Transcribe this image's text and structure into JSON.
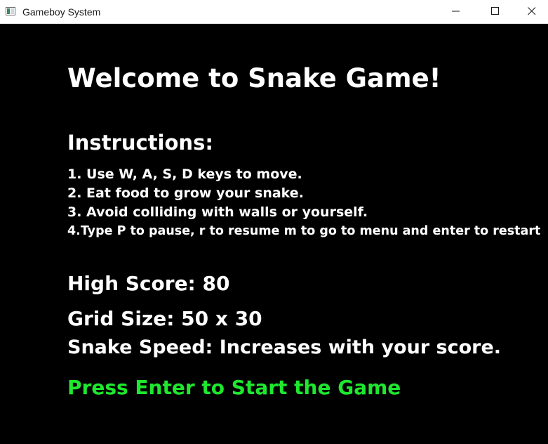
{
  "window": {
    "title": "Gameboy System"
  },
  "game": {
    "welcome": "Welcome to Snake Game!",
    "instructions_heading": "Instructions:",
    "instructions": [
      "1. Use W, A, S, D keys to move.",
      "2. Eat food to grow your snake.",
      "3. Avoid colliding with walls or yourself.",
      "4.Type P to pause, r to resume m to go to menu and enter to restart"
    ],
    "high_score": "High Score: 80",
    "grid_size": "Grid Size: 50 x 30",
    "snake_speed": "Snake Speed: Increases with your score.",
    "start_prompt": "Press Enter to Start the Game"
  },
  "colors": {
    "background": "#000000",
    "text": "#ffffff",
    "start_prompt": "#1ee82e"
  }
}
